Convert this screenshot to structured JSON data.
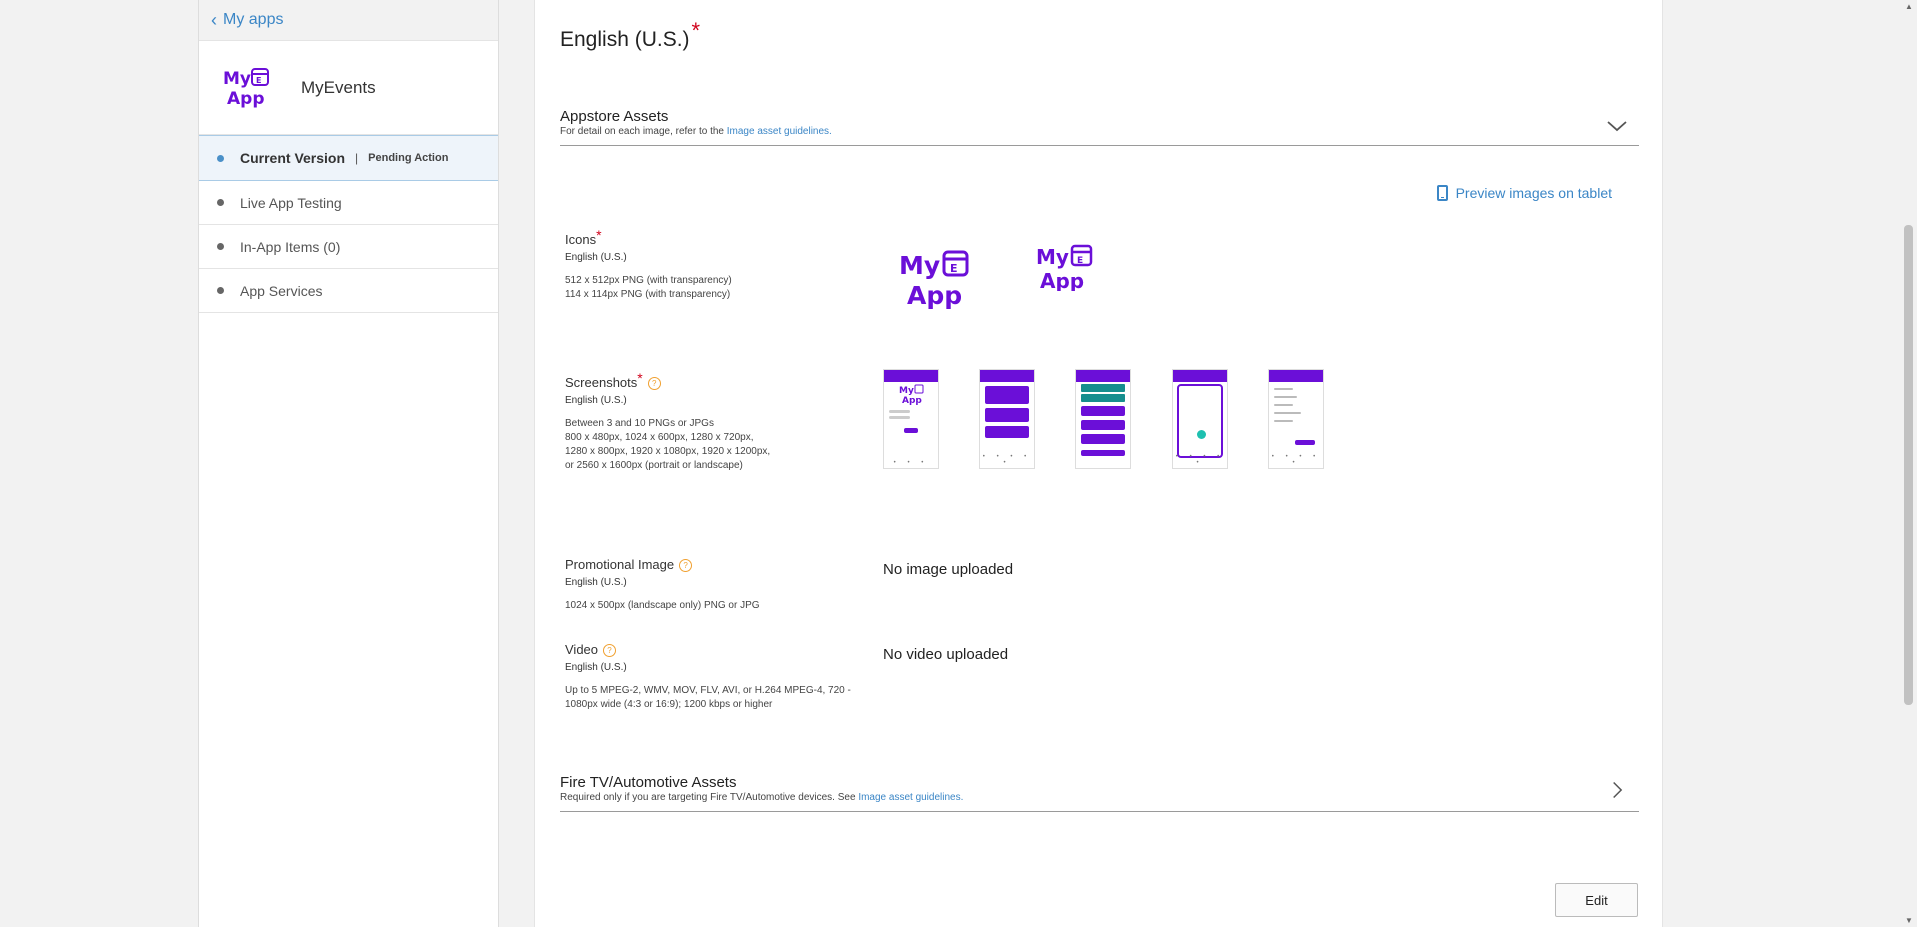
{
  "sidebar": {
    "back_label": "My apps",
    "app_name": "MyEvents",
    "logo_text": "My App",
    "items": [
      {
        "label": "Current Version",
        "sub": "Pending Action",
        "active": true
      },
      {
        "label": "Live App Testing"
      },
      {
        "label": "In-App Items (0)"
      },
      {
        "label": "App Services"
      }
    ]
  },
  "main": {
    "language_title": "English (U.S.)",
    "required_mark": "*",
    "appstore_section": {
      "title": "Appstore Assets",
      "desc_prefix": "For detail on each image, refer to the",
      "desc_link": "Image asset guidelines."
    },
    "preview_link": "Preview images on tablet",
    "icons": {
      "name": "Icons",
      "lang": "English (U.S.)",
      "spec": [
        "512 x 512px PNG (with transparency)",
        "114 x 114px PNG (with transparency)"
      ]
    },
    "screenshots": {
      "name": "Screenshots",
      "lang": "English (U.S.)",
      "spec": [
        "Between 3 and 10 PNGs or JPGs",
        "800 x 480px, 1024 x 600px, 1280 x 720px,",
        "1280 x 800px, 1920 x 1080px, 1920 x 1200px,",
        "or 2560 x 1600px (portrait or landscape)"
      ]
    },
    "promo": {
      "name": "Promotional Image",
      "lang": "English (U.S.)",
      "spec": "1024 x 500px (landscape only) PNG or JPG",
      "empty": "No image uploaded"
    },
    "video": {
      "name": "Video",
      "lang": "English (U.S.)",
      "spec": [
        "Up to 5 MPEG-2, WMV, MOV, FLV, AVI, or H.264 MPEG-4, 720 -",
        "1080px wide (4:3 or 16:9); 1200 kbps or higher"
      ],
      "empty": "No video uploaded"
    },
    "firetv_section": {
      "title": "Fire TV/Automotive Assets",
      "desc_prefix": "Required only if you are targeting Fire TV/Automotive devices. See",
      "desc_link": "Image asset guidelines."
    },
    "edit_label": "Edit"
  },
  "colors": {
    "accent": "#3b86c6",
    "brand": "#6b0fd8",
    "required": "#d0021b",
    "help": "#f0a030"
  }
}
